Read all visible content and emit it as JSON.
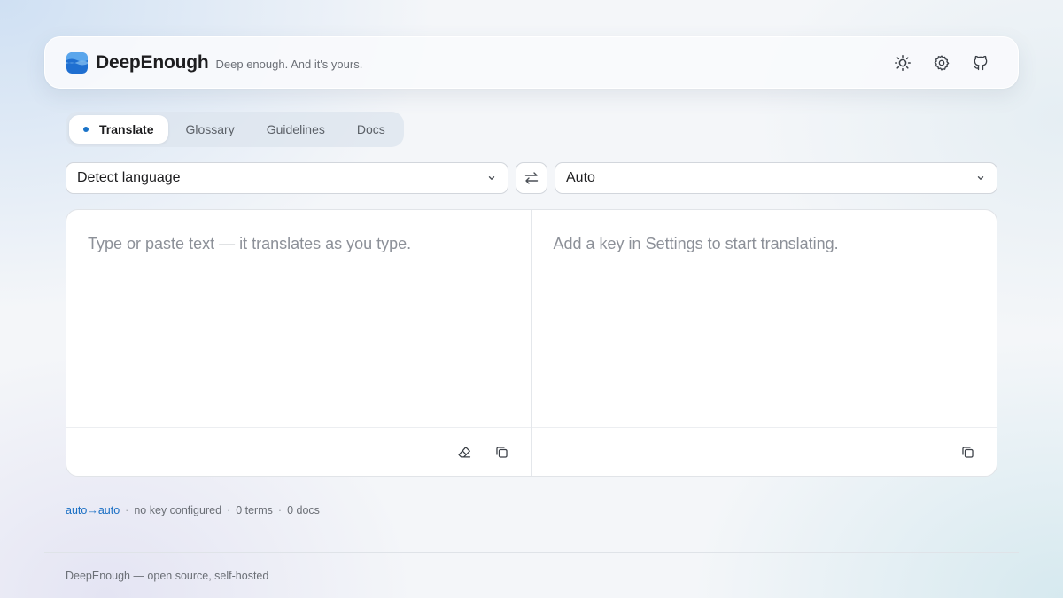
{
  "header": {
    "brand": "DeepEnough",
    "tagline": "Deep enough. And it's yours.",
    "actions": [
      "sun-icon",
      "gear-icon",
      "github-icon"
    ]
  },
  "tabs": [
    {
      "label": "Translate",
      "active": true
    },
    {
      "label": "Glossary",
      "active": false
    },
    {
      "label": "Guidelines",
      "active": false
    },
    {
      "label": "Docs",
      "active": false
    }
  ],
  "languages": {
    "source": "Detect language",
    "target": "Auto"
  },
  "editor": {
    "input_placeholder": "Type or paste text — it translates as you type.",
    "output_placeholder": "Add a key in Settings to start translating."
  },
  "status": {
    "pair": "auto→auto",
    "key": "no key configured",
    "terms": "0 terms",
    "docs": "0 docs",
    "separator": "·"
  },
  "footer": {
    "text": "DeepEnough — open source, self-hosted"
  },
  "colors": {
    "accent": "#1a73c8",
    "status_link": "#1a6fc4"
  }
}
